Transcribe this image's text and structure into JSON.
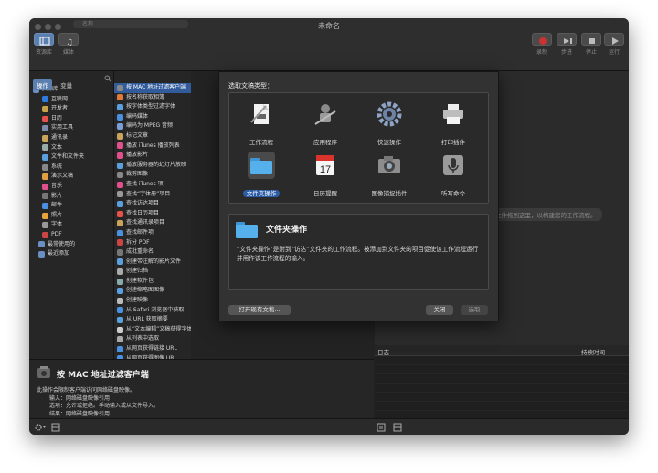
{
  "window": {
    "title": "未命名"
  },
  "toolbar": {
    "left_buttons": [
      {
        "label": "资源库",
        "icon": "library-icon"
      },
      {
        "label": "媒体",
        "icon": "media-icon"
      }
    ],
    "right_buttons": [
      {
        "label": "录制",
        "icon": "record-icon"
      },
      {
        "label": "步进",
        "icon": "step-icon"
      },
      {
        "label": "停止",
        "icon": "stop-icon"
      },
      {
        "label": "运行",
        "icon": "run-icon"
      }
    ]
  },
  "tabs": {
    "actions": "操作",
    "variables": "变量"
  },
  "search": {
    "placeholder": "名称"
  },
  "library": {
    "root": "资源库",
    "items": [
      "互联网",
      "开发者",
      "日历",
      "实用工具",
      "通讯录",
      "文本",
      "文件和文件夹",
      "系统",
      "演示文稿",
      "音乐",
      "影片",
      "邮件",
      "照片",
      "字体",
      "PDF"
    ],
    "footer": [
      "最常使用的",
      "最近添加"
    ]
  },
  "actions": [
    "按 MAC 地址过滤客户端",
    "按名称获取相簿",
    "按字体类型过滤字体",
    "编码媒体",
    "编码为 MPEG 音频",
    "标记文章",
    "播放 iTunes 播放列表",
    "播放影片",
    "播放服务器的幻灯片放映",
    "裁剪图像",
    "查找 iTunes 项",
    "查找“字体册”项目",
    "查找访达项目",
    "查找日历项目",
    "查找通讯录项目",
    "查找邮件项",
    "拆分 PDF",
    "成批重命名",
    "创建带注解的影片文件",
    "创建归档",
    "创建软件包",
    "创建缩略图图像",
    "创建映像",
    "从 Safari 浏览器中获取",
    "从 URL 获取摘要",
    "从“文本编辑”文稿获得字体",
    "从列表中选取",
    "从网页获得链接 URL",
    "从网页获得图像 URL",
    "从网页中获得文本"
  ],
  "description": {
    "title": "按 MAC 地址过滤客户端",
    "summary": "此操作会限制客户端访问网络磁盘映像。",
    "input_label": "输入：",
    "input_value": "网络磁盘映像引用",
    "options_label": "选项：",
    "options_value": "允许或拒绝。手动输入或从文件导入。",
    "result_label": "结果：",
    "result_value": "网络磁盘映像引用"
  },
  "workflow": {
    "hint": "将操作或文件拖到这里，以构建您的工作流程。"
  },
  "log": {
    "col_log": "日志",
    "col_duration": "持续时间"
  },
  "sheet": {
    "heading": "选取文稿类型：",
    "types": [
      {
        "label": "工作流程",
        "icon": "workflow-icon"
      },
      {
        "label": "应用程序",
        "icon": "application-icon"
      },
      {
        "label": "快速操作",
        "icon": "gear-icon"
      },
      {
        "label": "打印插件",
        "icon": "printer-icon"
      },
      {
        "label": "文件夹操作",
        "icon": "folder-icon",
        "selected": true
      },
      {
        "label": "日历提醒",
        "icon": "calendar-icon",
        "day": "17"
      },
      {
        "label": "图像捕捉插件",
        "icon": "camera-icon"
      },
      {
        "label": "听写命令",
        "icon": "microphone-icon"
      }
    ],
    "detail_title": "文件夹操作",
    "detail_text": "“文件夹操作”是附到“访达”文件夹的工作流程。被添加到文件夹的项目促使该工作流程运行并用作该工作流程的输入。",
    "open_existing": "打开现有文稿...",
    "close": "关闭",
    "choose": "选取"
  },
  "colors": {
    "accent": "#2d5da8",
    "selection": "#315b9b",
    "record": "#c83232"
  }
}
